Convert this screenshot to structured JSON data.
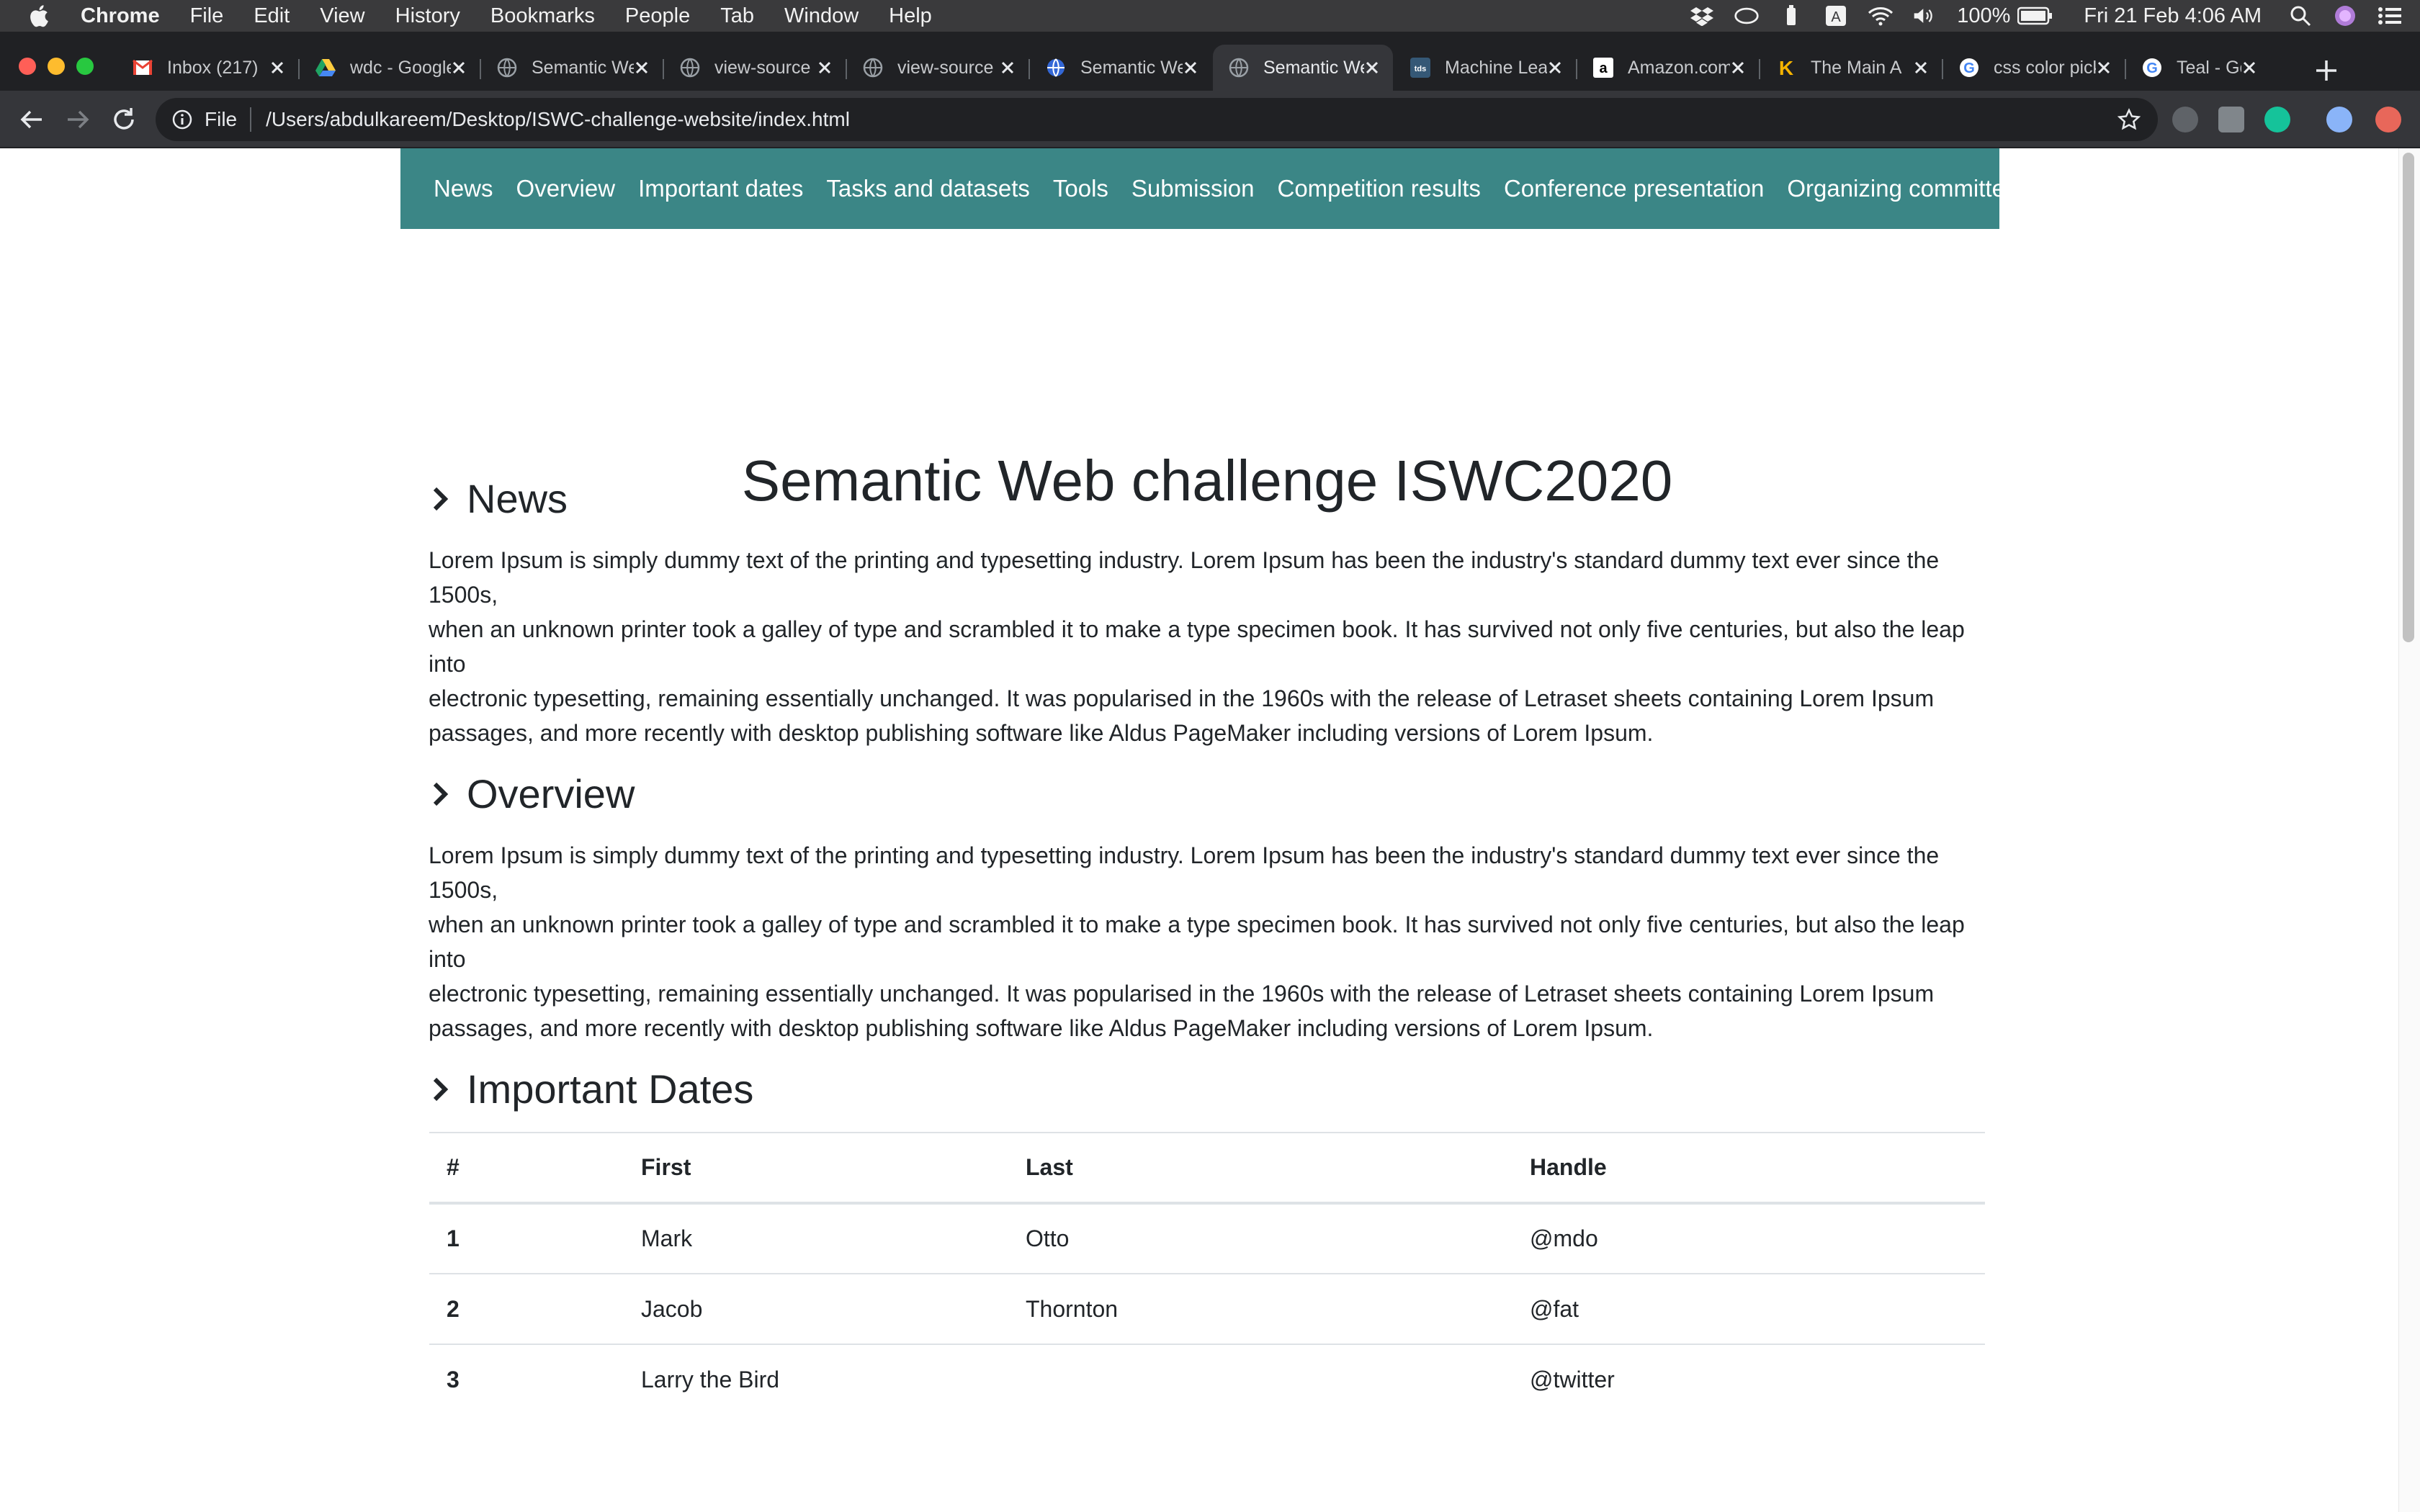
{
  "menubar": {
    "app": "Chrome",
    "items": [
      "File",
      "Edit",
      "View",
      "History",
      "Bookmarks",
      "People",
      "Tab",
      "Window",
      "Help"
    ],
    "battery": "100%",
    "clock": "Fri 21 Feb  4:06 AM"
  },
  "tabs": [
    {
      "title": "Inbox (217)",
      "icon": "gmail-icon"
    },
    {
      "title": "wdc - Google Drive",
      "icon": "google-drive-icon"
    },
    {
      "title": "Semantic Web",
      "icon": "globe-icon"
    },
    {
      "title": "view-source",
      "icon": "globe-icon"
    },
    {
      "title": "view-source",
      "icon": "globe-icon"
    },
    {
      "title": "Semantic Web",
      "icon": "shield-globe-icon"
    },
    {
      "title": "Semantic Web",
      "icon": "globe-icon",
      "active": true
    },
    {
      "title": "Machine Learning",
      "icon": "tds-icon"
    },
    {
      "title": "Amazon.com",
      "icon": "amazon-icon"
    },
    {
      "title": "The Main A",
      "icon": "k-icon"
    },
    {
      "title": "css color picker",
      "icon": "google-icon"
    },
    {
      "title": "Teal - Google",
      "icon": "google-icon"
    }
  ],
  "omnibox": {
    "scheme": "File",
    "url": "/Users/abdulkareem/Desktop/ISWC-challenge-website/index.html"
  },
  "site": {
    "nav": [
      "News",
      "Overview",
      "Important dates",
      "Tasks and datasets",
      "Tools",
      "Submission",
      "Competition results",
      "Conference presentation",
      "Organizing committee"
    ],
    "title": "Semantic Web challenge ISWC2020",
    "sections": {
      "news": {
        "heading": "News",
        "lines": [
          "Lorem Ipsum is simply dummy text of the printing and typesetting industry. Lorem Ipsum has been the industry's standard dummy text ever since the 1500s,",
          "when an unknown printer took a galley of type and scrambled it to make a type specimen book. It has survived not only five centuries, but also the leap into",
          "electronic typesetting, remaining essentially unchanged. It was popularised in the 1960s with the release of Letraset sheets containing Lorem Ipsum",
          "passages, and more recently with desktop publishing software like Aldus PageMaker including versions of Lorem Ipsum."
        ]
      },
      "overview": {
        "heading": "Overview",
        "lines": [
          "Lorem Ipsum is simply dummy text of the printing and typesetting industry. Lorem Ipsum has been the industry's standard dummy text ever since the 1500s,",
          "when an unknown printer took a galley of type and scrambled it to make a type specimen book. It has survived not only five centuries, but also the leap into",
          "electronic typesetting, remaining essentially unchanged. It was popularised in the 1960s with the release of Letraset sheets containing Lorem Ipsum",
          "passages, and more recently with desktop publishing software like Aldus PageMaker including versions of Lorem Ipsum."
        ]
      },
      "dates": {
        "heading": "Important Dates",
        "columns": [
          "#",
          "First",
          "Last",
          "Handle"
        ],
        "rows": [
          [
            "1",
            "Mark",
            "Otto",
            "@mdo"
          ],
          [
            "2",
            "Jacob",
            "Thornton",
            "@fat"
          ],
          [
            "3",
            "Larry the Bird",
            "",
            "@twitter"
          ]
        ]
      }
    }
  },
  "colors": {
    "nav_bg": "#3b8686",
    "menubar_bg": "#3a3a3c",
    "tabstrip_bg": "#202124",
    "toolbar_bg": "#35363a"
  }
}
